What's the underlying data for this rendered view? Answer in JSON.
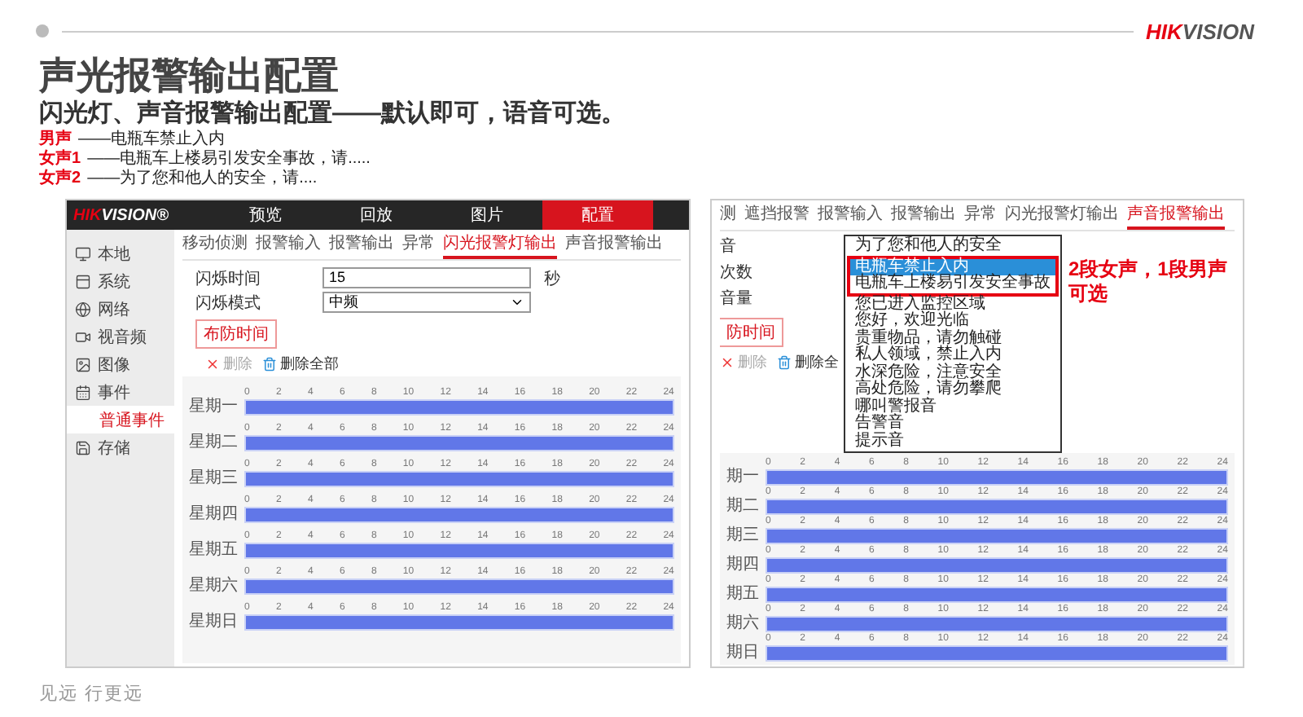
{
  "header": {
    "logo": {
      "accent": "HIK",
      "rest": "VISION"
    }
  },
  "title": "声光报警输出配置",
  "subtitle": "闪光灯、声音报警输出配置——默认即可，语音可选。",
  "voice_notes": [
    {
      "label": "男声",
      "text": "——电瓶车禁止入内"
    },
    {
      "label": "女声1",
      "text": "——电瓶车上楼易引发安全事故，请....."
    },
    {
      "label": "女声2",
      "text": "——为了您和他人的安全，请...."
    }
  ],
  "config_screen": {
    "logo": {
      "accent": "HIK",
      "rest": "VISION®"
    },
    "nav": [
      {
        "label": "预览",
        "selected": false
      },
      {
        "label": "回放",
        "selected": false
      },
      {
        "label": "图片",
        "selected": false
      },
      {
        "label": "配置",
        "selected": true
      }
    ],
    "sidebar": [
      {
        "label": "本地",
        "kind": "item",
        "selected": false
      },
      {
        "label": "系统",
        "kind": "item",
        "selected": false
      },
      {
        "label": "网络",
        "kind": "item",
        "selected": false
      },
      {
        "label": "视音频",
        "kind": "item",
        "selected": false
      },
      {
        "label": "图像",
        "kind": "item",
        "selected": false
      },
      {
        "label": "事件",
        "kind": "item",
        "selected": false
      },
      {
        "label": "普通事件",
        "kind": "subitem",
        "selected": true
      },
      {
        "label": "存储",
        "kind": "item",
        "selected": false
      }
    ],
    "tabs": [
      {
        "label": "移动侦测",
        "selected": false
      },
      {
        "label": "报警输入",
        "selected": false
      },
      {
        "label": "报警输出",
        "selected": false
      },
      {
        "label": "异常",
        "selected": false
      },
      {
        "label": "闪光报警灯输出",
        "selected": true
      },
      {
        "label": "声音报警输出",
        "selected": false
      }
    ],
    "fields": [
      {
        "label": "闪烁时间",
        "kind": "input",
        "value": "15",
        "unit": "秒"
      },
      {
        "label": "闪烁模式",
        "kind": "select",
        "value": "中频"
      }
    ],
    "schedule_button": "布防时间",
    "delete_button": {
      "label": "删除",
      "disabled": true
    },
    "delete_all_button": "删除全部",
    "schedule": [
      {
        "day": "星期一",
        "ticks": [
          "0",
          "2",
          "4",
          "6",
          "8",
          "10",
          "12",
          "14",
          "16",
          "18",
          "20",
          "22",
          "24"
        ]
      },
      {
        "day": "星期二",
        "ticks": [
          "0",
          "2",
          "4",
          "6",
          "8",
          "10",
          "12",
          "14",
          "16",
          "18",
          "20",
          "22",
          "24"
        ]
      },
      {
        "day": "星期三",
        "ticks": [
          "0",
          "2",
          "4",
          "6",
          "8",
          "10",
          "12",
          "14",
          "16",
          "18",
          "20",
          "22",
          "24"
        ]
      },
      {
        "day": "星期四",
        "ticks": [
          "0",
          "2",
          "4",
          "6",
          "8",
          "10",
          "12",
          "14",
          "16",
          "18",
          "20",
          "22",
          "24"
        ]
      },
      {
        "day": "星期五",
        "ticks": [
          "0",
          "2",
          "4",
          "6",
          "8",
          "10",
          "12",
          "14",
          "16",
          "18",
          "20",
          "22",
          "24"
        ]
      },
      {
        "day": "星期六",
        "ticks": [
          "0",
          "2",
          "4",
          "6",
          "8",
          "10",
          "12",
          "14",
          "16",
          "18",
          "20",
          "22",
          "24"
        ]
      },
      {
        "day": "星期日",
        "ticks": [
          "0",
          "2",
          "4",
          "6",
          "8",
          "10",
          "12",
          "14",
          "16",
          "18",
          "20",
          "22",
          "24"
        ]
      }
    ]
  },
  "voice_screen": {
    "tabs": [
      {
        "label": "测",
        "selected": false
      },
      {
        "label": "遮挡报警",
        "selected": false
      },
      {
        "label": "报警输入",
        "selected": false
      },
      {
        "label": "报警输出",
        "selected": false
      },
      {
        "label": "异常",
        "selected": false
      },
      {
        "label": "闪光报警灯输出",
        "selected": false
      },
      {
        "label": "声音报警输出",
        "selected": true
      }
    ],
    "field_labels": [
      "音",
      "次数",
      "音量"
    ],
    "schedule_button": "防时间",
    "delete_button": {
      "label": "删除",
      "disabled": true
    },
    "delete_all_button": "删除全",
    "options": [
      {
        "label": "为了您和他人的安全",
        "selected": false,
        "boxed": false
      },
      {
        "label": "电瓶车禁止入内",
        "selected": true,
        "boxed": true
      },
      {
        "label": "电瓶车上楼易引发安全事故",
        "selected": false,
        "boxed": true
      },
      {
        "label": "您已进入监控区域",
        "selected": false,
        "boxed": false
      },
      {
        "label": "您好，欢迎光临",
        "selected": false,
        "boxed": false
      },
      {
        "label": "贵重物品，请勿触碰",
        "selected": false,
        "boxed": false
      },
      {
        "label": "私人领域，禁止入内",
        "selected": false,
        "boxed": false
      },
      {
        "label": "水深危险，注意安全",
        "selected": false,
        "boxed": false
      },
      {
        "label": "高处危险，请勿攀爬",
        "selected": false,
        "boxed": false
      },
      {
        "label": "哪叫警报音",
        "selected": false,
        "boxed": false
      },
      {
        "label": "告警音",
        "selected": false,
        "boxed": false
      },
      {
        "label": "提示音",
        "selected": false,
        "boxed": false
      }
    ],
    "note": "2段女声，1段男声可选",
    "schedule": [
      {
        "day": "期一",
        "ticks": [
          "0",
          "2",
          "4",
          "6",
          "8",
          "10",
          "12",
          "14",
          "16",
          "18",
          "20",
          "22",
          "24"
        ]
      },
      {
        "day": "期二",
        "ticks": [
          "0",
          "2",
          "4",
          "6",
          "8",
          "10",
          "12",
          "14",
          "16",
          "18",
          "20",
          "22",
          "24"
        ]
      },
      {
        "day": "期三",
        "ticks": [
          "0",
          "2",
          "4",
          "6",
          "8",
          "10",
          "12",
          "14",
          "16",
          "18",
          "20",
          "22",
          "24"
        ]
      },
      {
        "day": "期四",
        "ticks": [
          "0",
          "2",
          "4",
          "6",
          "8",
          "10",
          "12",
          "14",
          "16",
          "18",
          "20",
          "22",
          "24"
        ]
      },
      {
        "day": "期五",
        "ticks": [
          "0",
          "2",
          "4",
          "6",
          "8",
          "10",
          "12",
          "14",
          "16",
          "18",
          "20",
          "22",
          "24"
        ]
      },
      {
        "day": "期六",
        "ticks": [
          "0",
          "2",
          "4",
          "6",
          "8",
          "10",
          "12",
          "14",
          "16",
          "18",
          "20",
          "22",
          "24"
        ]
      },
      {
        "day": "期日",
        "ticks": [
          "0",
          "2",
          "4",
          "6",
          "8",
          "10",
          "12",
          "14",
          "16",
          "18",
          "20",
          "22",
          "24"
        ]
      }
    ]
  },
  "footer": "见远 行更远"
}
